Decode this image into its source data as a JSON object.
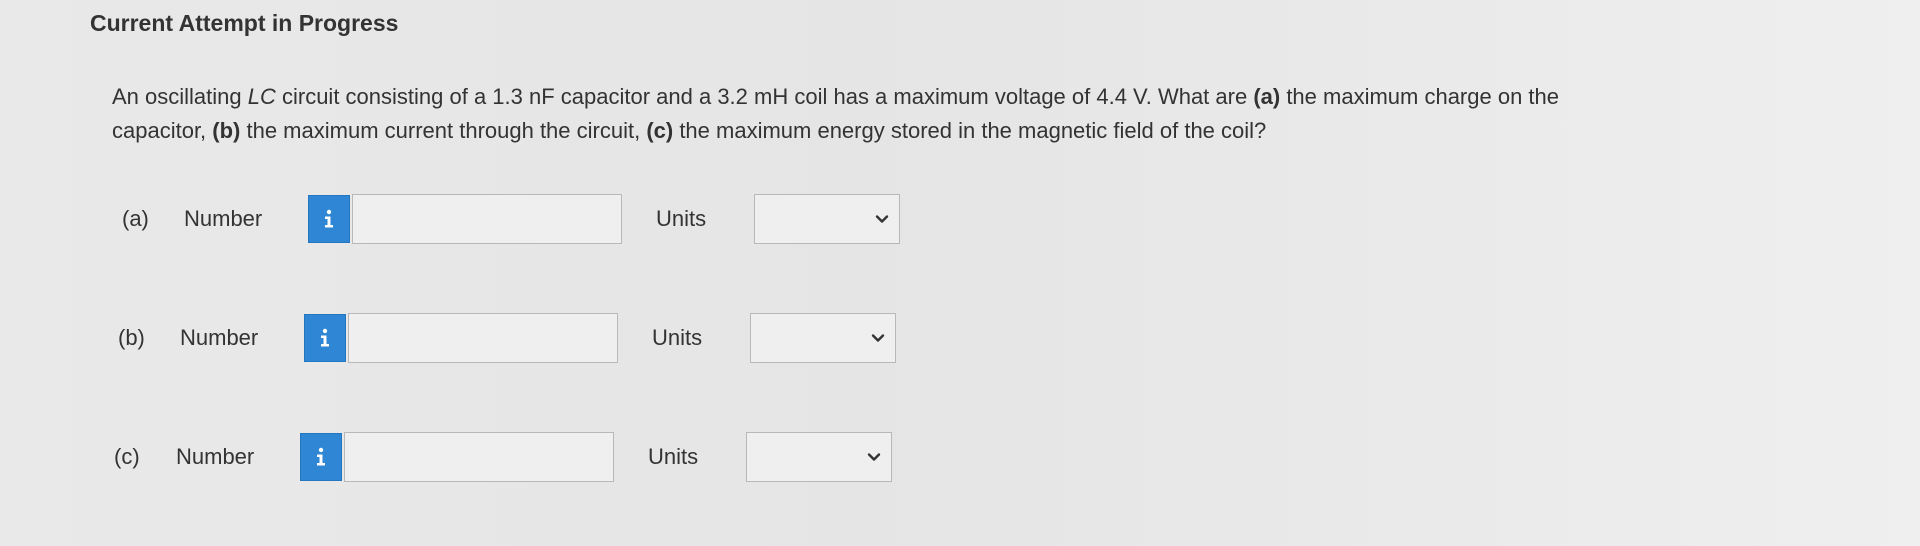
{
  "header": {
    "status": "Current Attempt in Progress"
  },
  "question": {
    "segments": [
      {
        "text": "An oscillating ",
        "style": "normal"
      },
      {
        "text": "LC",
        "style": "italic"
      },
      {
        "text": " circuit consisting of a 1.3 nF capacitor and a 3.2 mH coil has a maximum voltage of 4.4 V. What are ",
        "style": "normal"
      },
      {
        "text": "(a)",
        "style": "bold"
      },
      {
        "text": " the maximum charge on the capacitor, ",
        "style": "normal"
      },
      {
        "text": "(b)",
        "style": "bold"
      },
      {
        "text": " the maximum current through the circuit, ",
        "style": "normal"
      },
      {
        "text": "(c)",
        "style": "bold"
      },
      {
        "text": " the maximum energy stored in the magnetic field of the coil?",
        "style": "normal"
      }
    ]
  },
  "answers": [
    {
      "part": "(a)",
      "label": "Number",
      "value": "",
      "units_label": "Units",
      "units_value": ""
    },
    {
      "part": "(b)",
      "label": "Number",
      "value": "",
      "units_label": "Units",
      "units_value": ""
    },
    {
      "part": "(c)",
      "label": "Number",
      "value": "",
      "units_label": "Units",
      "units_value": ""
    }
  ],
  "icons": {
    "info": "info-icon",
    "dropdown": "chevron-down-icon"
  },
  "colors": {
    "info_button": "#2e86d4",
    "text": "#333333",
    "background": "#e8e8e8"
  }
}
